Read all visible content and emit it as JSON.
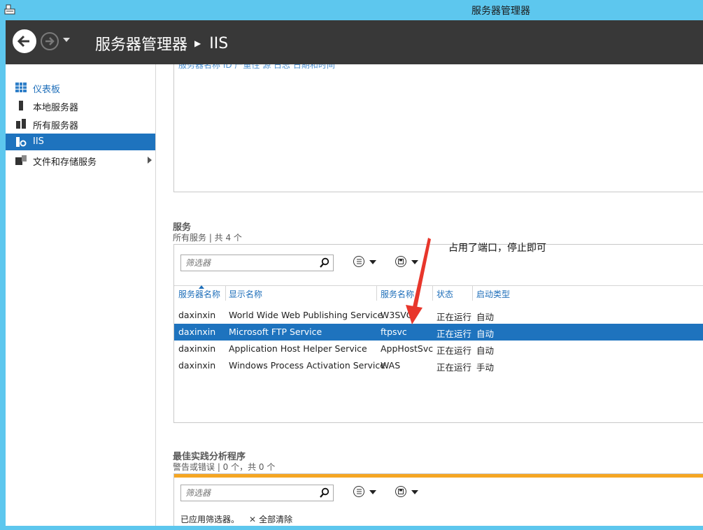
{
  "window": {
    "title": "服务器管理器"
  },
  "header": {
    "crumb_root": "服务器管理器",
    "crumb_current": "IIS"
  },
  "sidebar": {
    "items": [
      {
        "label": "仪表板"
      },
      {
        "label": "本地服务器"
      },
      {
        "label": "所有服务器"
      },
      {
        "label": "IIS"
      },
      {
        "label": "文件和存储服务"
      }
    ]
  },
  "top_panel": {
    "cut_headers": "服务器名称   ID     严重性   源                                   日志   日期和时间"
  },
  "services": {
    "title": "服务",
    "subtitle": "所有服务 | 共 4 个",
    "filter_placeholder": "筛选器",
    "columns": [
      "服务器名称",
      "显示名称",
      "服务名称",
      "状态",
      "启动类型"
    ],
    "rows": [
      {
        "server": "daxinxin",
        "display": "World Wide Web Publishing Service",
        "name": "W3SVC",
        "status": "正在运行",
        "startup": "自动",
        "selected": false
      },
      {
        "server": "daxinxin",
        "display": "Microsoft FTP Service",
        "name": "ftpsvc",
        "status": "正在运行",
        "startup": "自动",
        "selected": true
      },
      {
        "server": "daxinxin",
        "display": "Application Host Helper Service",
        "name": "AppHostSvc",
        "status": "正在运行",
        "startup": "自动",
        "selected": false
      },
      {
        "server": "daxinxin",
        "display": "Windows Process Activation Service",
        "name": "WAS",
        "status": "正在运行",
        "startup": "手动",
        "selected": false
      }
    ]
  },
  "bpa": {
    "title": "最佳实践分析程序",
    "subtitle": "警告或错误 | 0 个，共 0 个",
    "filter_placeholder": "筛选器",
    "applied_text": "已应用筛选器。",
    "clear_all": "全部清除"
  },
  "annotation": {
    "text": "占用了端口，停止即可",
    "color": "#e8362b"
  },
  "colors": {
    "titlebar": "#5dc7ee",
    "header": "#383838",
    "selection": "#1e73be",
    "link": "#1f6fba",
    "bpa_bar": "#f5a623"
  }
}
